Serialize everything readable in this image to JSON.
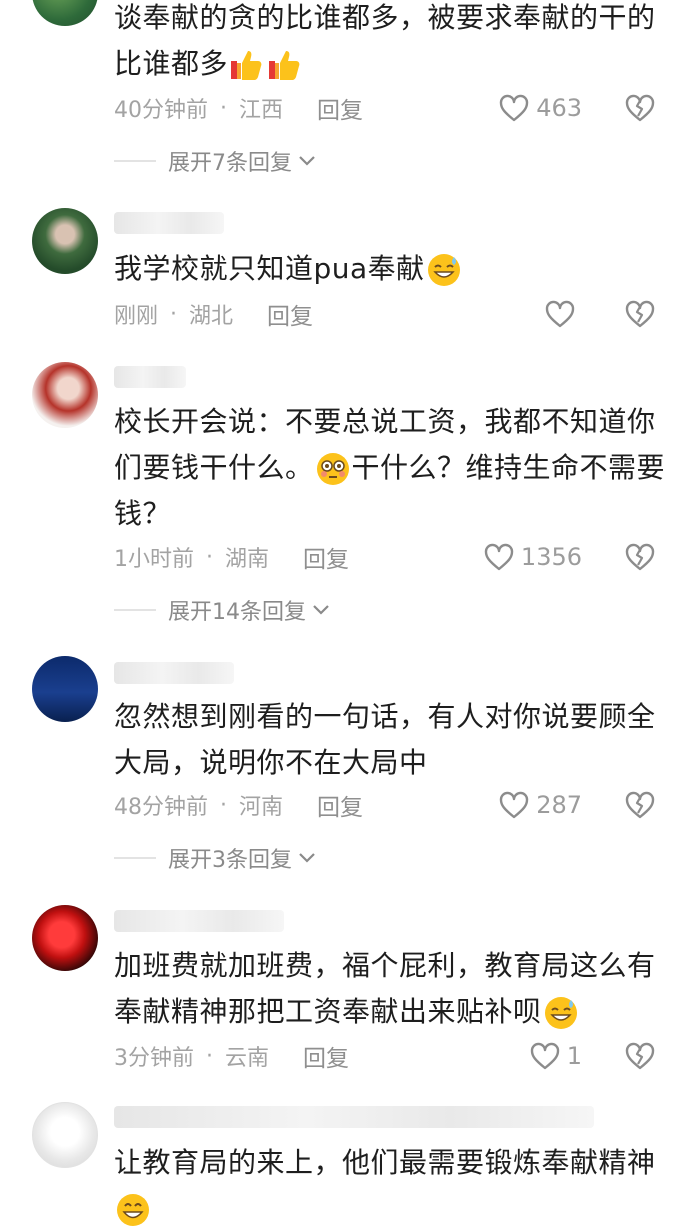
{
  "comments": [
    {
      "text_lines": [
        "谈奉献的贪的比谁都多，被要求奉献的干的",
        "比谁都多"
      ],
      "emoji_after": "thumbs-up-thumbs-up",
      "time": "40分钟前",
      "location": "江西",
      "reply_label": "回复",
      "like_count": "463",
      "expand_label": "展开7条回复"
    },
    {
      "text_lines": [
        "我学校就只知道pua奉献"
      ],
      "emoji_after": "sweat-smile",
      "time": "刚刚",
      "location": "湖北",
      "reply_label": "回复",
      "like_count": ""
    },
    {
      "text_lines": [
        "校长开会说：不要总说工资，我都不知道你",
        "们要钱干什么。",
        "干什么？维持生命不需要",
        "钱？"
      ],
      "time": "1小时前",
      "location": "湖南",
      "reply_label": "回复",
      "like_count": "1356",
      "expand_label": "展开14条回复"
    },
    {
      "text_lines": [
        "忽然想到刚看的一句话，有人对你说要顾全",
        "大局，说明你不在大局中"
      ],
      "time": "48分钟前",
      "location": "河南",
      "reply_label": "回复",
      "like_count": "287",
      "expand_label": "展开3条回复"
    },
    {
      "text_lines": [
        "加班费就加班费，福个屁利，教育局这么有",
        "奉献精神那把工资奉献出来贴补呗"
      ],
      "time": "3分钟前",
      "location": "云南",
      "reply_label": "回复",
      "like_count": "1"
    },
    {
      "text_lines": [
        "让教育局的来上，他们最需要锻炼奉献精神"
      ]
    }
  ],
  "icons": [
    "heart-outline-icon",
    "dislike-heart-icon",
    "chevron-down-icon",
    "thumbs-up-emoji",
    "sweat-smile-emoji",
    "flushed-emoji",
    "grin-emoji"
  ]
}
